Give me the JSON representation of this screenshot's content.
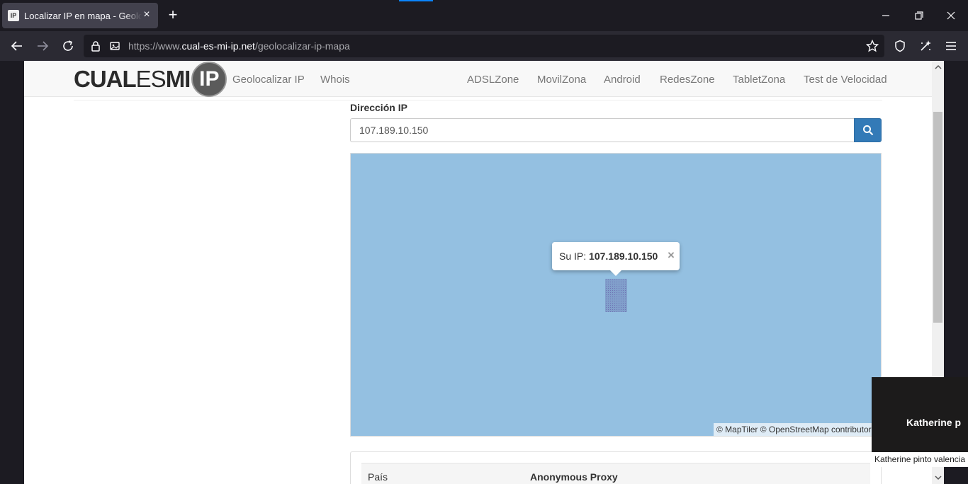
{
  "browser": {
    "tab": {
      "favicon_text": "IP",
      "title": "Localizar IP en mapa - Geolocalizar IP"
    },
    "url": {
      "prefix": "https://www.",
      "domain": "cual-es-mi-ip.net",
      "path": "/geolocalizar-ip-mapa"
    },
    "accent_color": "#0a84ff"
  },
  "site": {
    "logo": {
      "part1": "CUAL",
      "part2": "ES",
      "part3": "MI",
      "badge": "IP"
    },
    "menu_left": [
      "Geolocalizar IP",
      "Whois"
    ],
    "menu_right": [
      "ADSLZone",
      "MovilZona",
      "Android",
      "RedesZone",
      "TabletZona",
      "Test de Velocidad"
    ]
  },
  "form": {
    "label": "Dirección IP",
    "value": "107.189.10.150",
    "button_color": "#337ab7"
  },
  "map": {
    "water_color": "#94c0e1",
    "popup": {
      "prefix": "Su IP:",
      "ip": "107.189.10.150",
      "close": "×"
    },
    "attribution": "© MapTiler © OpenStreetMap contributors"
  },
  "info": {
    "rows": [
      {
        "key": "País",
        "value": "Anonymous Proxy"
      }
    ]
  },
  "overlay": {
    "name": "Katherine  p",
    "caption": "Katherine pinto valencia"
  }
}
